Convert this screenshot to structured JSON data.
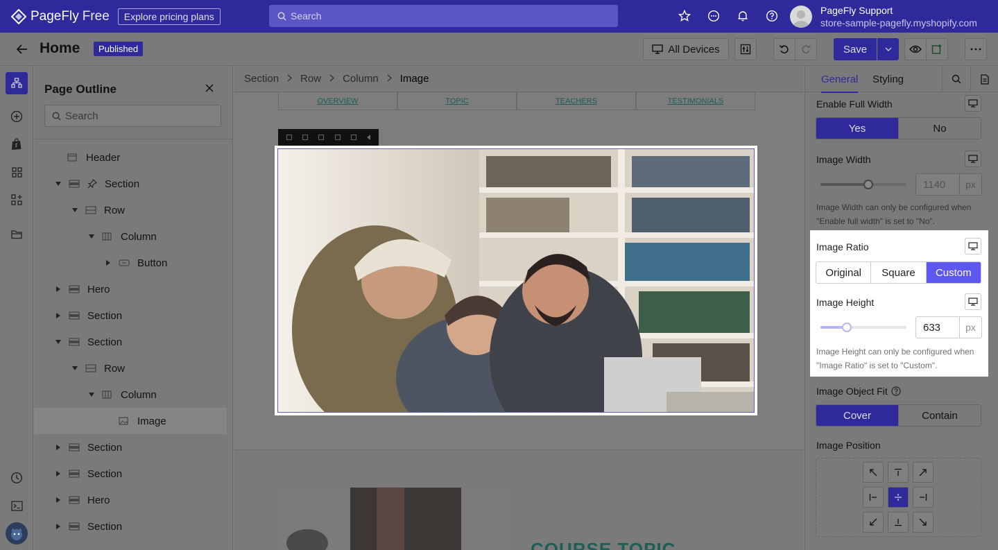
{
  "app": {
    "brand": "PageFly",
    "brand_suffix": "Free",
    "pricing_label": "Explore pricing plans",
    "search_placeholder": "Search",
    "user_name": "PageFly Support",
    "user_store": "store-sample-pagefly.myshopify.com"
  },
  "page": {
    "title": "Home",
    "status": "Published",
    "devices_label": "All Devices",
    "save_label": "Save"
  },
  "outline": {
    "title": "Page Outline",
    "search_placeholder": "Search",
    "items": [
      {
        "label": "Header",
        "depth": 0,
        "caret": "none",
        "icon": "header-icon"
      },
      {
        "label": "Section",
        "depth": 0,
        "caret": "open",
        "icon": "section-icon",
        "pinned": true
      },
      {
        "label": "Row",
        "depth": 1,
        "caret": "open",
        "icon": "row-icon"
      },
      {
        "label": "Column",
        "depth": 2,
        "caret": "open",
        "icon": "column-icon"
      },
      {
        "label": "Button",
        "depth": 3,
        "caret": "closed",
        "icon": "button-icon"
      },
      {
        "label": "Hero",
        "depth": 0,
        "caret": "closed",
        "icon": "section-icon"
      },
      {
        "label": "Section",
        "depth": 0,
        "caret": "closed",
        "icon": "section-icon"
      },
      {
        "label": "Section",
        "depth": 0,
        "caret": "open",
        "icon": "section-icon"
      },
      {
        "label": "Row",
        "depth": 1,
        "caret": "open",
        "icon": "row-icon"
      },
      {
        "label": "Column",
        "depth": 2,
        "caret": "open",
        "icon": "column-icon"
      },
      {
        "label": "Image",
        "depth": 3,
        "caret": "none",
        "icon": "image-icon",
        "selected": true
      },
      {
        "label": "Section",
        "depth": 0,
        "caret": "closed",
        "icon": "section-icon"
      },
      {
        "label": "Section",
        "depth": 0,
        "caret": "closed",
        "icon": "section-icon"
      },
      {
        "label": "Hero",
        "depth": 0,
        "caret": "closed",
        "icon": "section-icon"
      },
      {
        "label": "Section",
        "depth": 0,
        "caret": "closed",
        "icon": "section-icon"
      }
    ]
  },
  "breadcrumb": [
    "Section",
    "Row",
    "Column",
    "Image"
  ],
  "canvas": {
    "nav_links": [
      "OVERVIEW",
      "TOPIC",
      "TEACHERS",
      "TESTIMONIALS"
    ],
    "course_heading": "COURSE TOPIC"
  },
  "inspector": {
    "tabs": [
      "General",
      "Styling"
    ],
    "full_width": {
      "label": "Enable Full Width",
      "options": [
        "Yes",
        "No"
      ],
      "selected": "Yes"
    },
    "image_width": {
      "label": "Image Width",
      "value": "1140",
      "unit": "px",
      "slider_fraction": 0.56,
      "hint": "Image Width can only be configured when \"Enable full width\" is set to \"No\"."
    },
    "image_ratio": {
      "label": "Image Ratio",
      "options": [
        "Original",
        "Square",
        "Custom"
      ],
      "selected": "Custom"
    },
    "image_height": {
      "label": "Image Height",
      "value": "633",
      "unit": "px",
      "slider_fraction": 0.31,
      "hint": "Image Height can only be configured when \"Image Ratio\" is set to \"Custom\"."
    },
    "object_fit": {
      "label": "Image Object Fit",
      "options": [
        "Cover",
        "Contain"
      ],
      "selected": "Cover"
    },
    "position": {
      "label": "Image Position",
      "selected": "center"
    }
  },
  "colors": {
    "brand": "#2e2a9c",
    "accent": "#5b57f0",
    "heading_teal": "#1f5e57"
  }
}
